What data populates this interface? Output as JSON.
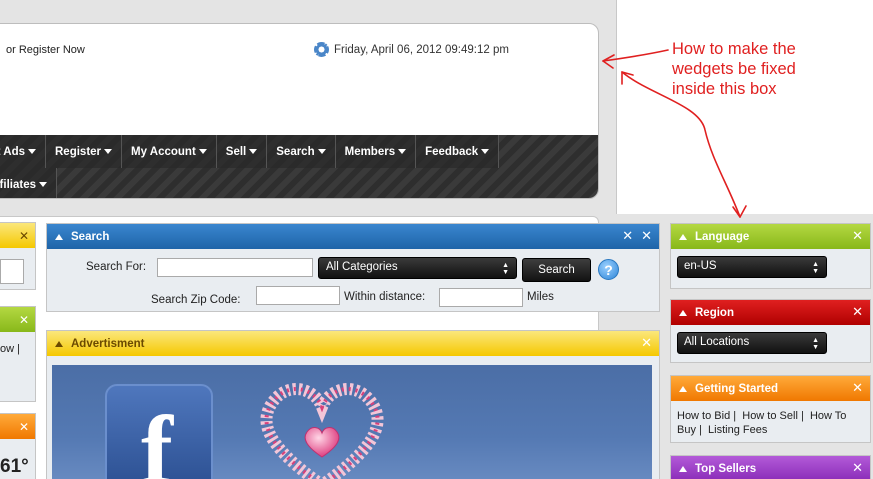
{
  "header": {
    "login_text": "or Register Now",
    "date": "Friday, April 06, 2012 09:49:12 pm"
  },
  "nav": {
    "row1": [
      "Want Ads",
      "Register",
      "My Account",
      "Sell",
      "Search",
      "Members",
      "Feedback"
    ],
    "row2": [
      "Affiliates"
    ]
  },
  "search_widget": {
    "title": "Search",
    "search_for_label": "Search For:",
    "category_value": "All Categories",
    "search_button": "Search",
    "help_glyph": "?",
    "zip_label": "Search Zip Code:",
    "distance_label": "Within distance:",
    "miles_label": "Miles"
  },
  "ad_widget": {
    "title": "Advertisment",
    "facebook_glyph": "f"
  },
  "language_widget": {
    "title": "Language",
    "value": "en-US"
  },
  "region_widget": {
    "title": "Region",
    "value": "All Locations"
  },
  "getting_started_widget": {
    "title": "Getting Started",
    "links": [
      "How to Bid",
      "How to Sell",
      "How To Buy",
      "Listing Fees"
    ],
    "separator": "|"
  },
  "top_sellers_widget": {
    "title": "Top Sellers"
  },
  "left_partial": {
    "text_fragment": "ow",
    "separator": "|",
    "temp_fragment": "61°"
  },
  "annotation": {
    "lines": [
      "How to make the",
      "wedgets be fixed",
      "inside this box"
    ]
  },
  "icons": {
    "tools": "✕",
    "close": "✕",
    "caret": "caret-down-icon",
    "collapse": "collapse-triangle-icon"
  },
  "colors": {
    "blue": "#2a72bb",
    "yellow": "#f5c800",
    "green": "#9cc82e",
    "red": "#c80000",
    "orange": "#f58a10",
    "purple": "#9c44c8",
    "annotation_red": "#e02020"
  }
}
